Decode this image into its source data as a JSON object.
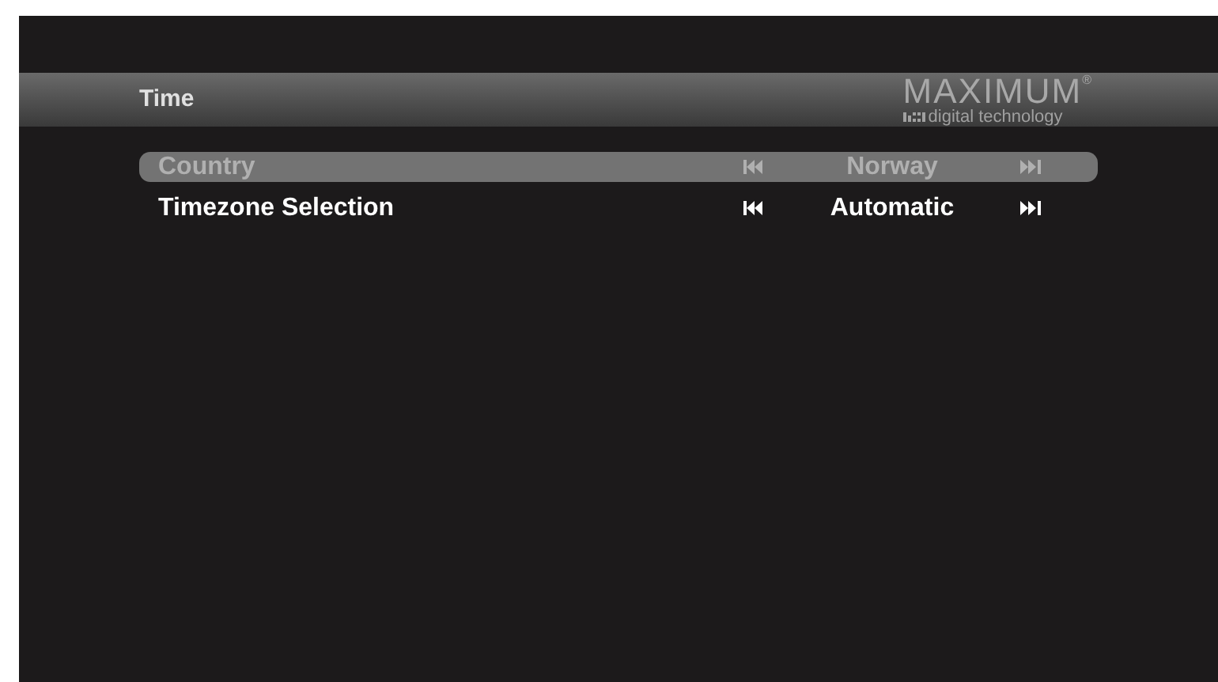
{
  "header": {
    "title": "Time",
    "logo": {
      "name": "MAXIMUM",
      "mark": "®",
      "tagline": "digital technology"
    }
  },
  "settings": [
    {
      "label": "Country",
      "value": "Norway",
      "selected": true
    },
    {
      "label": "Timezone Selection",
      "value": "Automatic",
      "selected": false
    }
  ]
}
